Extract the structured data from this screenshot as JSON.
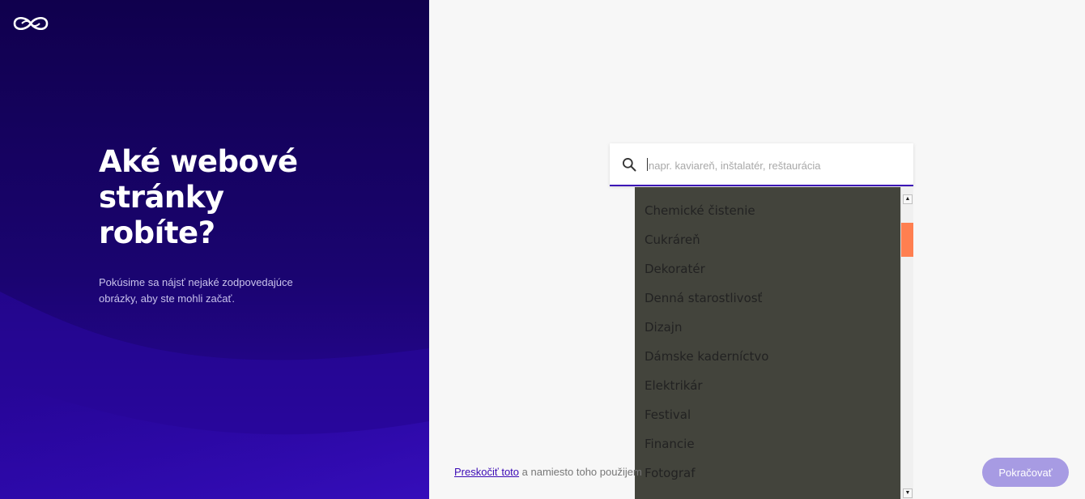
{
  "left": {
    "headline": "Aké webové stránky robíte?",
    "subtext": "Pokúsime sa nájsť nejaké zodpovedajúce obrázky, aby ste mohli začať."
  },
  "search": {
    "placeholder": "napr. kaviareň, inštalatér, reštaurácia",
    "value": ""
  },
  "dropdown": {
    "items": [
      "Chemické čistenie",
      "Cukráreň",
      "Dekoratér",
      "Denná starostlivosť",
      "Dizajn",
      "Dámske kaderníctvo",
      "Elektrikár",
      "Festival",
      "Financie",
      "Fotograf"
    ]
  },
  "footer": {
    "skip_link": "Preskočiť toto",
    "skip_rest": "a namiesto toho použijem"
  },
  "continue_button": "Pokračovať",
  "colors": {
    "accent": "#3b0ab5",
    "left_bg": "#120050",
    "dropdown_bg": "#43443c",
    "scroll_thumb": "#ff7f50",
    "button_bg": "#a79be3"
  }
}
